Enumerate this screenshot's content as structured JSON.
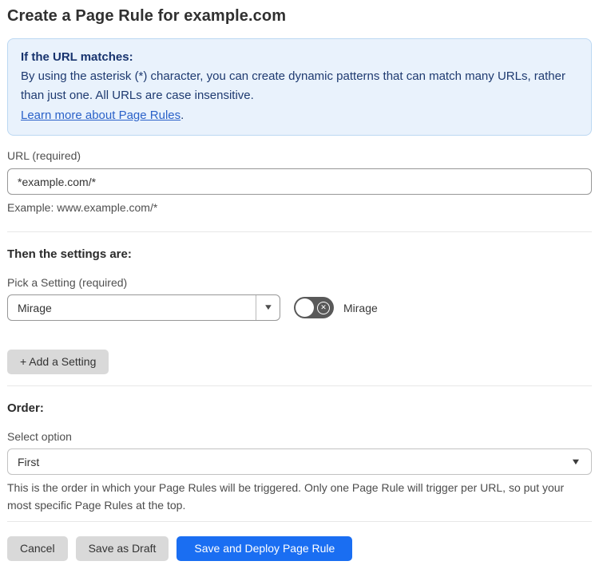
{
  "page": {
    "title": "Create a Page Rule for example.com"
  },
  "info_box": {
    "heading": "If the URL matches:",
    "body": "By using the asterisk (*) character, you can create dynamic patterns that can match many URLs, rather than just one. All URLs are case insensitive.",
    "link_text": "Learn more about Page Rules",
    "link_suffix": "."
  },
  "url_field": {
    "label": "URL (required)",
    "value": "*example.com/*",
    "helper": "Example: www.example.com/*"
  },
  "settings_section": {
    "heading": "Then the settings are:",
    "picker_label": "Pick a Setting (required)",
    "picker_value": "Mirage",
    "toggle_state": "off",
    "toggle_icon": "✕",
    "toggle_label": "Mirage",
    "add_button_label": "+ Add a Setting"
  },
  "order_section": {
    "heading": "Order:",
    "select_label": "Select option",
    "select_value": "First",
    "helper": "This is the order in which your Page Rules will be triggered. Only one Page Rule will trigger per URL, so put your most specific Page Rules at the top."
  },
  "footer": {
    "cancel_label": "Cancel",
    "save_draft_label": "Save as Draft",
    "save_deploy_label": "Save and Deploy Page Rule"
  },
  "icons": {
    "dropdown_arrow": "▼"
  },
  "colors": {
    "primary_blue": "#1a6ef2",
    "info_bg": "#e9f2fc",
    "info_border": "#bcd8f2",
    "info_text": "#1e3a70",
    "link_blue": "#2b62c9",
    "toggle_track": "#595959",
    "gray_button": "#d9d9d9"
  }
}
